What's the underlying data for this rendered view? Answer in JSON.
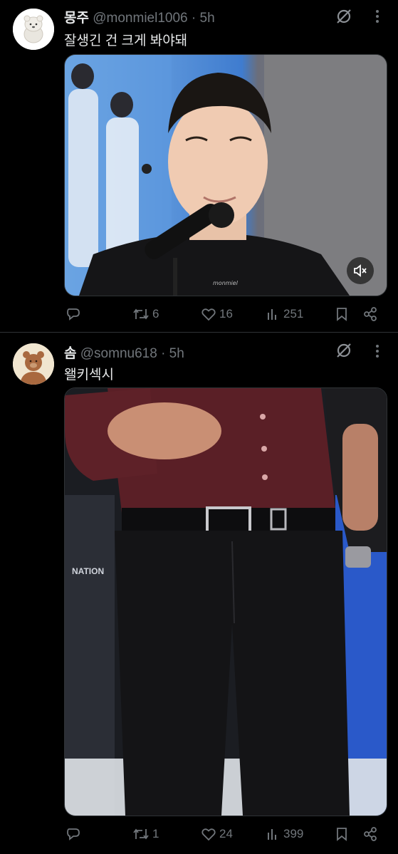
{
  "tweets": [
    {
      "display_name": "몽주",
      "handle": "@monmiel1006",
      "time": "· 5h",
      "text": "잘생긴 건 크게 봐야돼",
      "media_watermark": "monmiel",
      "replies": "",
      "reposts": "6",
      "likes": "16",
      "views": "251"
    },
    {
      "display_name": "솜",
      "handle": "@somnu618",
      "time": "· 5h",
      "text": "왤키섹시",
      "media_background_text": "NATION",
      "replies": "",
      "reposts": "1",
      "likes": "24",
      "views": "399"
    }
  ],
  "icons": {
    "grok": "grok-icon",
    "more": "more-icon",
    "reply": "reply-icon",
    "repost": "repost-icon",
    "like": "heart-icon",
    "views": "views-icon",
    "bookmark": "bookmark-icon",
    "share": "share-icon",
    "mute": "muted-speaker-icon"
  },
  "colors": {
    "background": "#000000",
    "text": "#e7e9ea",
    "secondary": "#71767b",
    "divider": "#2f3336"
  }
}
